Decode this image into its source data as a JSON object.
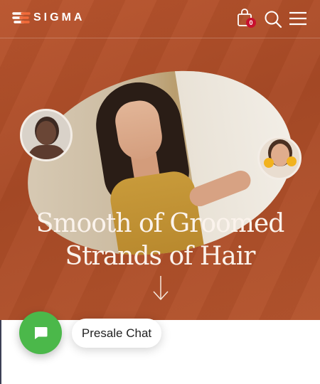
{
  "header": {
    "logo_text": "SIGMA",
    "cart_count": "0",
    "cart_icon": "shopping-bag-icon",
    "search_icon": "search-icon",
    "menu_icon": "hamburger-menu-icon"
  },
  "hero": {
    "headline_line1": "Smooth of Groomed",
    "headline_line2": "Strands of Hair",
    "scroll_icon": "arrow-down-icon"
  },
  "chat": {
    "label": "Presale Chat",
    "icon": "chat-bubble-icon"
  },
  "colors": {
    "hero_background": "#b0502a",
    "chat_button": "#4bb84a",
    "cart_badge": "#c8102e"
  }
}
